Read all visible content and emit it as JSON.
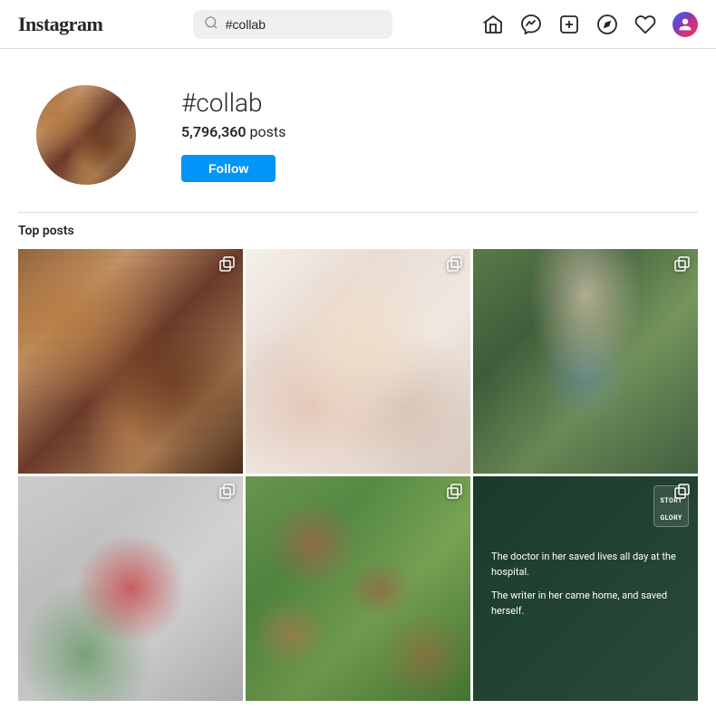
{
  "header": {
    "logo": "Instagram",
    "search": {
      "placeholder": "#collab",
      "value": "#collab"
    },
    "icons": {
      "home": "home-icon",
      "messenger": "messenger-icon",
      "add": "add-icon",
      "explore": "explore-icon",
      "heart": "heart-icon",
      "avatar": "user-avatar"
    }
  },
  "profile": {
    "hashtag": "#collab",
    "post_count_number": "5,796,360",
    "post_count_label": "posts",
    "follow_label": "Follow"
  },
  "sections": {
    "top_posts_label": "Top posts"
  },
  "grid": {
    "posts": [
      {
        "id": "post-1",
        "type": "food",
        "has_multiple": true
      },
      {
        "id": "post-2",
        "type": "baby",
        "has_multiple": true
      },
      {
        "id": "post-3",
        "type": "woman",
        "has_multiple": true
      },
      {
        "id": "post-4",
        "type": "red-dress",
        "has_multiple": true
      },
      {
        "id": "post-5",
        "type": "floral",
        "has_multiple": true
      },
      {
        "id": "post-6",
        "type": "dark-card",
        "has_multiple": true
      }
    ]
  },
  "dark_card": {
    "line1": "The doctor in her saved lives all day at the hospital.",
    "line2": "The writer in her came home, and saved herself.",
    "badge_line1": "STORY",
    "badge_line2": "GLORY"
  }
}
